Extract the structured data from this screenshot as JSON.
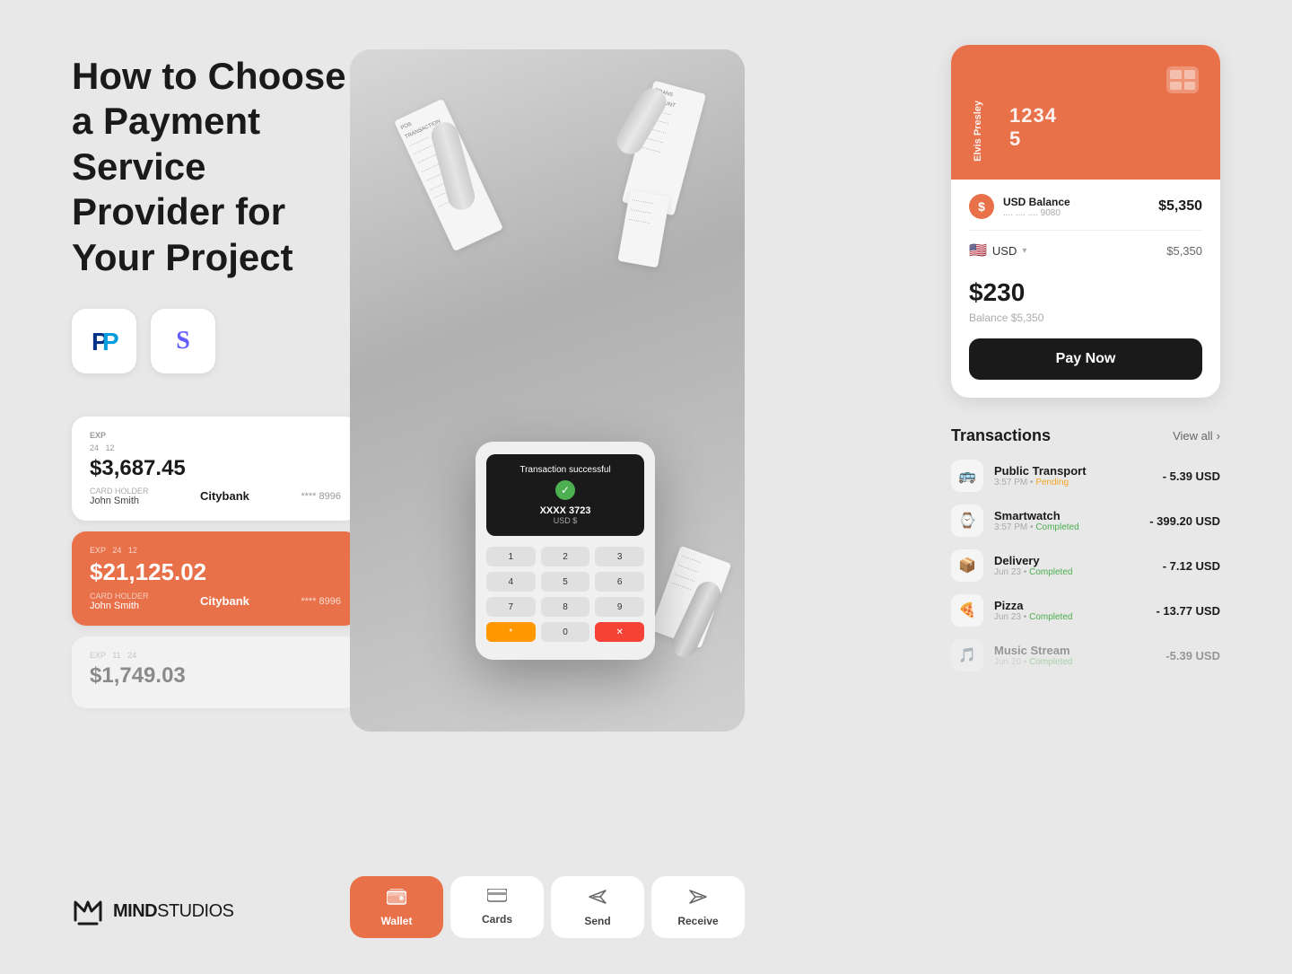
{
  "headline": "How to Choose a Payment\nService Provider for Your\nProject",
  "logos": [
    {
      "id": "paypal",
      "symbol": "P",
      "color": "#003087"
    },
    {
      "id": "stripe",
      "symbol": "S",
      "color": "#635bff"
    }
  ],
  "cards": [
    {
      "exp_label": "EXP",
      "exp_val": "24\n12",
      "amount": "$3,687.45",
      "holder_label": "Card holder",
      "holder_name": "John Smith",
      "bank": "Citybank",
      "card_number": "**** 8996",
      "style": "white"
    },
    {
      "exp_label": "EXP",
      "exp_val": "24\n12",
      "amount": "$21,125.02",
      "holder_label": "Card holder",
      "holder_name": "John Smith",
      "bank": "Citybank",
      "card_number": "**** 8996",
      "style": "orange"
    },
    {
      "exp_label": "EXP",
      "exp_val": "11\n24",
      "amount": "$1,749.03",
      "holder_label": "",
      "holder_name": "",
      "bank": "",
      "card_number": "",
      "style": "faded"
    }
  ],
  "pos_terminal": {
    "success_text": "Transaction successful",
    "card_number": "XXXX 3723",
    "currency": "USD $",
    "keys": [
      "1",
      "2",
      "3",
      "4",
      "5",
      "6",
      "7",
      "8",
      "9",
      "*",
      "0",
      "#"
    ]
  },
  "nav_tabs": [
    {
      "label": "Wallet",
      "icon": "wallet",
      "active": true
    },
    {
      "label": "Cards",
      "icon": "card",
      "active": false
    },
    {
      "label": "Send",
      "icon": "send",
      "active": false
    },
    {
      "label": "Receive",
      "icon": "receive",
      "active": false
    }
  ],
  "payment_widget": {
    "card": {
      "holder_name": "Elvis Presley",
      "number_display": "1234\n5",
      "chip": true
    },
    "balance_label": "USD Balance",
    "balance_card_num": ".... .... .... 9080",
    "balance_amount": "$5,350",
    "currency_flag": "🇺🇸",
    "currency_code": "USD",
    "currency_amount": "$5,350",
    "send_amount": "$",
    "send_number": "230",
    "balance_sub": "Balance  $5,350",
    "pay_now_label": "Pay Now"
  },
  "transactions": {
    "title": "Transactions",
    "view_all": "View all",
    "items": [
      {
        "name": "Public Transport",
        "date": "3:57 PM",
        "status": "Pending",
        "amount": "- 5.39 USD",
        "icon": "🚌"
      },
      {
        "name": "Smartwatch",
        "date": "3:57 PM",
        "status": "Completed",
        "amount": "- 399.20 USD",
        "icon": "⌚"
      },
      {
        "name": "Delivery",
        "date": "Jun 23",
        "status": "Completed",
        "amount": "- 7.12 USD",
        "icon": "📦"
      },
      {
        "name": "Pizza",
        "date": "Jun 23",
        "status": "Completed",
        "amount": "- 13.77 USD",
        "icon": "🍕"
      },
      {
        "name": "Music Stream",
        "date": "Jun 20",
        "status": "Completed",
        "amount": "-5.39 USD",
        "icon": "🎵",
        "faded": true
      }
    ]
  },
  "brand": {
    "name_bold": "MIND",
    "name_regular": "STUDIOS"
  }
}
